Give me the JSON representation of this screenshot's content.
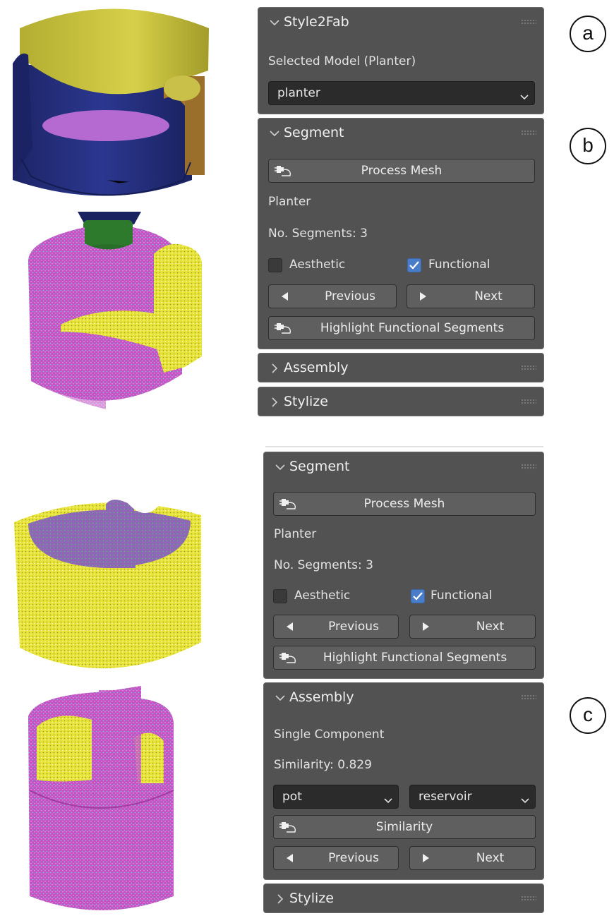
{
  "colors": {
    "panel_bg": "#525252",
    "button_bg": "#5f5f5f",
    "dropdown_bg": "#2b2b2b",
    "checkbox_checked": "#4a7dc9",
    "mesh_magenta": "#c84fc0",
    "mesh_yellow": "#e4e03a",
    "mesh_blue": "#26307a",
    "mesh_green": "#2f7a2a"
  },
  "annotations": {
    "a": "a",
    "b": "b",
    "c": "c"
  },
  "top": {
    "style2fab": {
      "title": "Style2Fab",
      "selected_label": "Selected Model (Planter)",
      "model_value": "planter"
    },
    "segment": {
      "title": "Segment",
      "process_mesh": "Process Mesh",
      "model_name": "Planter",
      "segments": "No. Segments: 3",
      "aesthetic": "Aesthetic",
      "aesthetic_checked": false,
      "functional": "Functional",
      "functional_checked": true,
      "previous": "Previous",
      "next": "Next",
      "highlight": "Highlight Functional Segments"
    },
    "assembly": {
      "title": "Assembly"
    },
    "stylize": {
      "title": "Stylize"
    }
  },
  "bottom": {
    "segment": {
      "title": "Segment",
      "process_mesh": "Process Mesh",
      "model_name": "Planter",
      "segments": "No. Segments: 3",
      "aesthetic": "Aesthetic",
      "aesthetic_checked": false,
      "functional": "Functional",
      "functional_checked": true,
      "previous": "Previous",
      "next": "Next",
      "highlight": "Highlight Functional Segments"
    },
    "assembly": {
      "title": "Assembly",
      "mode": "Single Component",
      "similarity": "Similarity: 0.829",
      "component_a": "pot",
      "component_b": "reservoir",
      "similarity_button": "Similarity",
      "previous": "Previous",
      "next": "Next"
    },
    "stylize": {
      "title": "Stylize"
    }
  }
}
